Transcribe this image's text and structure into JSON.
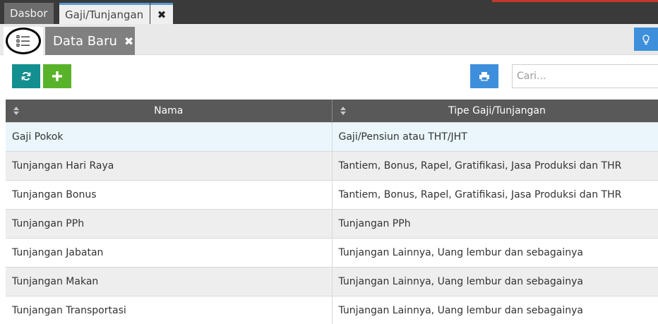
{
  "tabs": {
    "dasbor": "Dasbor",
    "active": "Gaji/Tunjangan",
    "close_glyph": "✖"
  },
  "toolbar": {
    "new_tab_label": "Data Baru",
    "new_tab_close": "✖"
  },
  "search": {
    "placeholder": "Cari...",
    "value": ""
  },
  "table": {
    "columns": [
      "Nama",
      "Tipe Gaji/Tunjangan"
    ],
    "rows": [
      {
        "nama": "Gaji Pokok",
        "tipe": "Gaji/Pensiun atau THT/JHT"
      },
      {
        "nama": "Tunjangan Hari Raya",
        "tipe": "Tantiem, Bonus, Rapel, Gratifikasi, Jasa Produksi dan THR"
      },
      {
        "nama": "Tunjangan Bonus",
        "tipe": "Tantiem, Bonus, Rapel, Gratifikasi, Jasa Produksi dan THR"
      },
      {
        "nama": "Tunjangan PPh",
        "tipe": "Tunjangan PPh"
      },
      {
        "nama": "Tunjangan Jabatan",
        "tipe": "Tunjangan Lainnya, Uang lembur dan sebagainya"
      },
      {
        "nama": "Tunjangan Makan",
        "tipe": "Tunjangan Lainnya, Uang lembur dan sebagainya"
      },
      {
        "nama": "Tunjangan Transportasi",
        "tipe": "Tunjangan Lainnya, Uang lembur dan sebagainya"
      }
    ]
  },
  "icons": {
    "list": "list-icon",
    "refresh": "refresh-icon",
    "add": "plus-icon",
    "print": "print-icon",
    "help": "lightbulb-icon",
    "sort": "sort-icon"
  },
  "colors": {
    "refresh": "#138f8f",
    "add": "#59b32a",
    "print": "#3e8fdb",
    "header": "#595959",
    "selected_row": "#eaf6fb"
  }
}
